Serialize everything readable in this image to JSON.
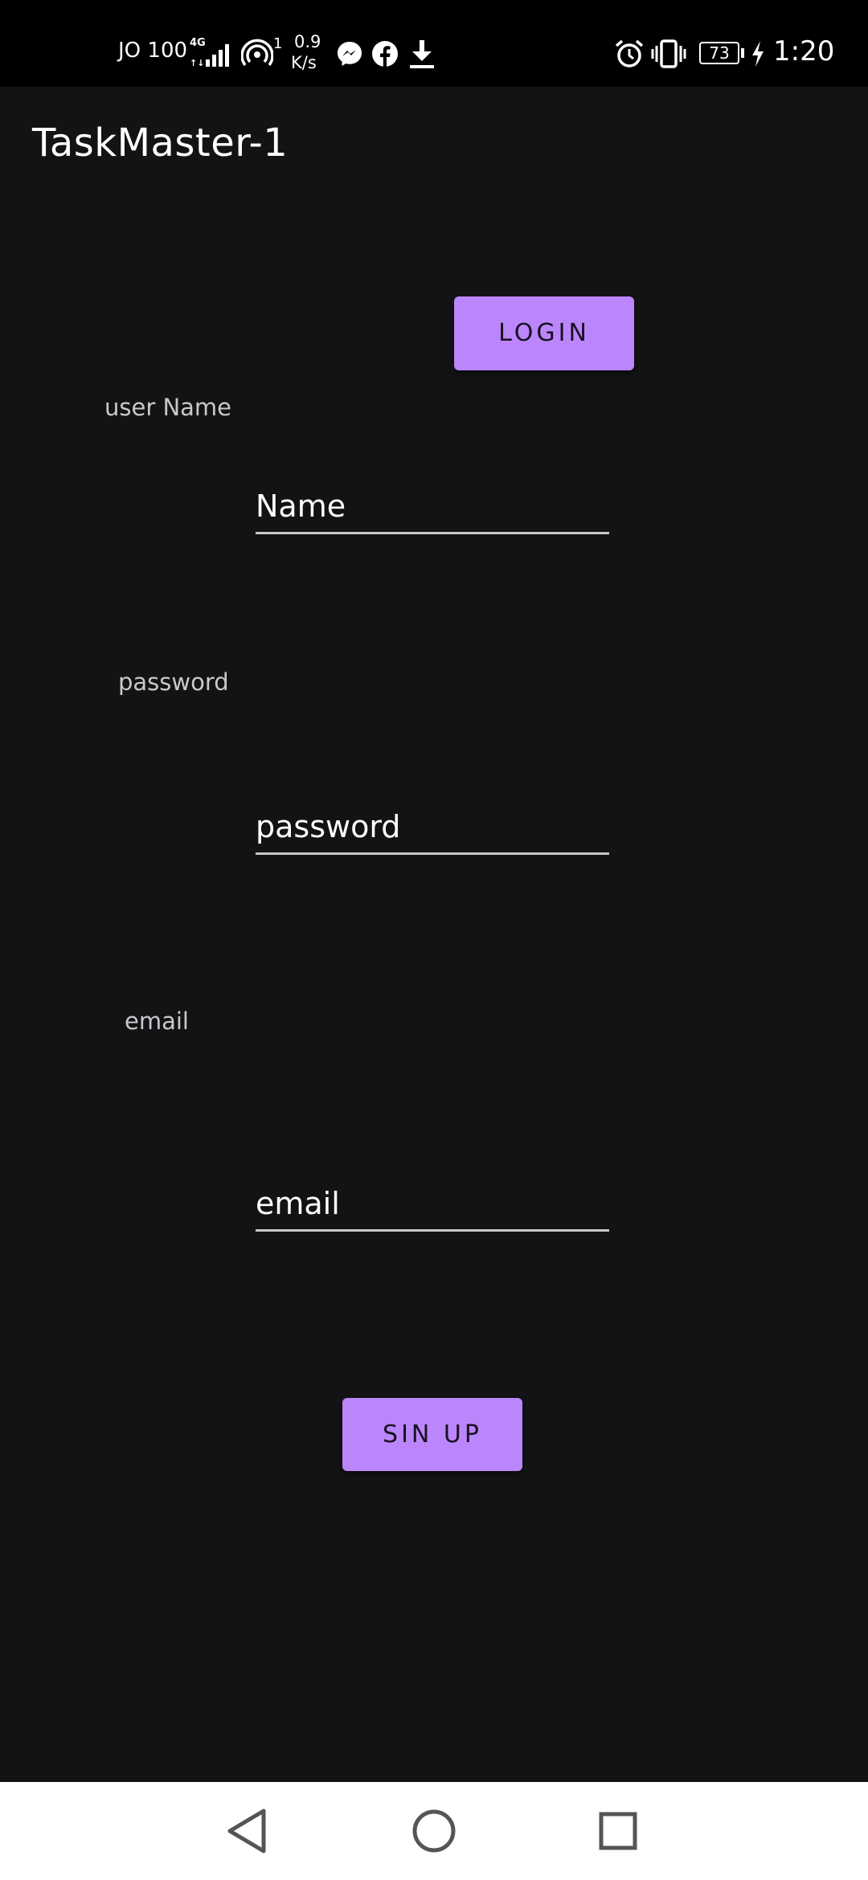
{
  "status_bar": {
    "carrier": "JO 100",
    "network": "4G",
    "hotspot_count": "1",
    "speed_value": "0.9",
    "speed_unit": "K/s",
    "battery": "73",
    "time": "1:20",
    "icons": [
      "signal-icon",
      "hotspot-icon",
      "messenger-icon",
      "facebook-icon",
      "download-icon",
      "alarm-icon",
      "vibrate-icon",
      "battery-icon",
      "charging-icon"
    ]
  },
  "app": {
    "title": "TaskMaster-1"
  },
  "form": {
    "login_label": "LOGIN",
    "username_label": "user Name",
    "username_placeholder": "Name",
    "password_label": "password",
    "password_placeholder": "password",
    "email_label": "email",
    "email_placeholder": "email",
    "signup_label": "SIN UP"
  },
  "nav": {
    "icons": [
      "back-icon",
      "home-icon",
      "recents-icon"
    ]
  },
  "colors": {
    "background": "#131315",
    "accent": "#bb86fc",
    "status_bar": "#000000",
    "nav_bar": "#ffffff"
  }
}
